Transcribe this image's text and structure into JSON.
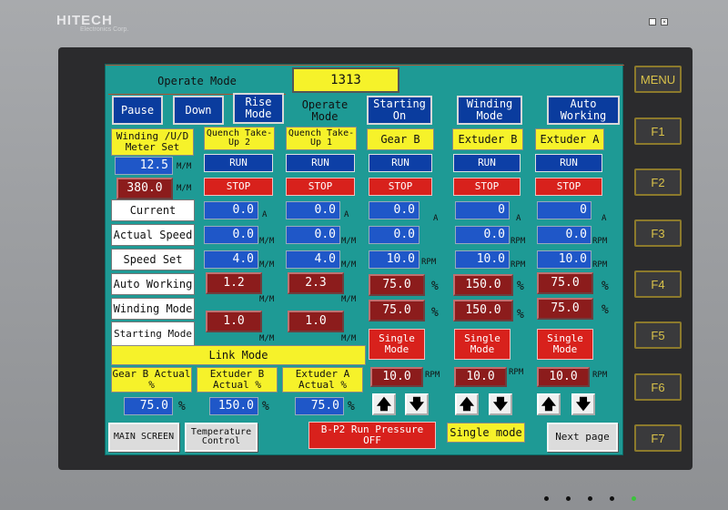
{
  "brand": {
    "logo": "HITECH",
    "sub": "Electronics Corp."
  },
  "header": {
    "title": "Operate Mode",
    "counter": "1313"
  },
  "mode_buttons": {
    "pause": "Pause",
    "down": "Down",
    "rise": "Rise Mode",
    "operate_mode": "Operate Mode",
    "starting": "Starting On",
    "winding": "Winding Mode",
    "auto": "Auto Working"
  },
  "columns": [
    {
      "title": "Winding /U/D Meter Set"
    },
    {
      "title": "Quench Take-Up 2",
      "run": "RUN",
      "stop": "STOP",
      "current": "0.0",
      "actual": "0.0",
      "set": "4.0",
      "auto": "1.2",
      "start": "1.0"
    },
    {
      "title": "Quench Take-Up 1",
      "run": "RUN",
      "stop": "STOP",
      "current": "0.0",
      "actual": "0.0",
      "set": "4.0",
      "auto": "2.3",
      "start": "1.0"
    },
    {
      "title": "Gear B",
      "run": "RUN",
      "stop": "STOP",
      "current": "0.0",
      "actual": "0.0",
      "set": "10.0",
      "auto": "75.0",
      "wind": "75.0",
      "single": "Single Mode",
      "sval": "10.0"
    },
    {
      "title": "Extuder B",
      "run": "RUN",
      "stop": "STOP",
      "current": "0",
      "actual": "0.0",
      "set": "10.0",
      "auto": "150.0",
      "wind": "150.0",
      "single": "Single Mode",
      "sval": "10.0"
    },
    {
      "title": "Extuder A",
      "run": "RUN",
      "stop": "STOP",
      "current": "0",
      "actual": "0.0",
      "set": "10.0",
      "auto": "75.0",
      "wind": "75.0",
      "single": "Single Mode",
      "sval": "10.0"
    }
  ],
  "meter": {
    "speed": "12.5",
    "length": "380.0"
  },
  "row_labels": {
    "current": "Current",
    "actual": "Actual Speed",
    "set": "Speed Set",
    "auto": "Auto Working",
    "wind": "Winding Mode",
    "start": "Starting Mode"
  },
  "units": {
    "mm": "M/M",
    "a": "A",
    "rpm": "RPM",
    "pct": "%"
  },
  "link": {
    "title": "Link Mode",
    "items": [
      {
        "label": "Gear B Actual %",
        "value": "75.0"
      },
      {
        "label": "Extuder B Actual %",
        "value": "150.0"
      },
      {
        "label": "Extuder A Actual %",
        "value": "75.0"
      }
    ]
  },
  "arrows": {
    "up": "🡅",
    "down": "🡇"
  },
  "footer": {
    "main": "MAIN SCREEN",
    "temp": "Temperature Control",
    "pressure": "B-P2 Run Pressure OFF",
    "single": "Single mode",
    "next": "Next page"
  },
  "fkeys": [
    "MENU",
    "F1",
    "F2",
    "F3",
    "F4",
    "F5",
    "F6",
    "F7"
  ]
}
